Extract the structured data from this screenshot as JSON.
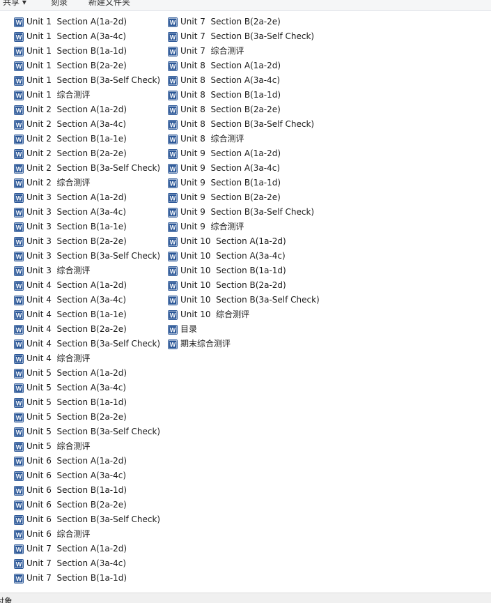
{
  "toolbar": {
    "items": [
      "共享 ▾",
      "刻录",
      "新建文件夹"
    ]
  },
  "file_list": {
    "icon": "word-doc-icon",
    "columns": [
      [
        "Unit 1  Section A(1a-2d)",
        "Unit 1  Section A(3a-4c)",
        "Unit 1  Section B(1a-1d)",
        "Unit 1  Section B(2a-2e)",
        "Unit 1  Section B(3a-Self Check)",
        "Unit 1  综合测评",
        "Unit 2  Section A(1a-2d)",
        "Unit 2  Section A(3a-4c)",
        "Unit 2  Section B(1a-1e)",
        "Unit 2  Section B(2a-2e)",
        "Unit 2  Section B(3a-Self Check)",
        "Unit 2  综合测评",
        "Unit 3  Section A(1a-2d)",
        "Unit 3  Section A(3a-4c)",
        "Unit 3  Section B(1a-1e)",
        "Unit 3  Section B(2a-2e)",
        "Unit 3  Section B(3a-Self Check)",
        "Unit 3  综合测评",
        "Unit 4  Section A(1a-2d)",
        "Unit 4  Section A(3a-4c)",
        "Unit 4  Section B(1a-1e)",
        "Unit 4  Section B(2a-2e)",
        "Unit 4  Section B(3a-Self Check)",
        "Unit 4  综合测评",
        "Unit 5  Section A(1a-2d)",
        "Unit 5  Section A(3a-4c)",
        "Unit 5  Section B(1a-1d)",
        "Unit 5  Section B(2a-2e)",
        "Unit 5  Section B(3a-Self Check)",
        "Unit 5  综合测评",
        "Unit 6  Section A(1a-2d)",
        "Unit 6  Section A(3a-4c)",
        "Unit 6  Section B(1a-1d)",
        "Unit 6  Section B(2a-2e)",
        "Unit 6  Section B(3a-Self Check)",
        "Unit 6  综合测评",
        "Unit 7  Section A(1a-2d)",
        "Unit 7  Section A(3a-4c)",
        "Unit 7  Section B(1a-1d)"
      ],
      [
        "Unit 7  Section B(2a-2e)",
        "Unit 7  Section B(3a-Self Check)",
        "Unit 7  综合测评",
        "Unit 8  Section A(1a-2d)",
        "Unit 8  Section A(3a-4c)",
        "Unit 8  Section B(1a-1d)",
        "Unit 8  Section B(2a-2e)",
        "Unit 8  Section B(3a-Self Check)",
        "Unit 8  综合测评",
        "Unit 9  Section A(1a-2d)",
        "Unit 9  Section A(3a-4c)",
        "Unit 9  Section B(1a-1d)",
        "Unit 9  Section B(2a-2e)",
        "Unit 9  Section B(3a-Self Check)",
        "Unit 9  综合测评",
        "Unit 10  Section A(1a-2d)",
        "Unit 10  Section A(3a-4c)",
        "Unit 10  Section B(1a-1d)",
        "Unit 10  Section B(2a-2d)",
        "Unit 10  Section B(3a-Self Check)",
        "Unit 10  综合测评",
        "目录",
        "期末综合测评"
      ]
    ]
  },
  "statusbar": {
    "text": "对象"
  },
  "colors": {
    "word_blue": "#2b5797",
    "toolbar_bg": "#f5f6f7",
    "statusbar_bg": "#f0f0f0"
  }
}
